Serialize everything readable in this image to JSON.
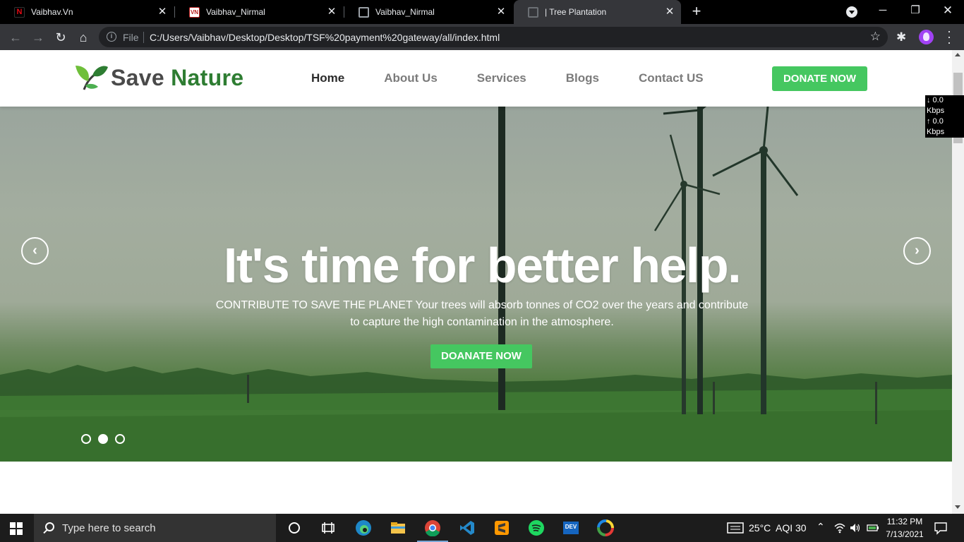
{
  "tabs": [
    {
      "title": "Vaibhav.Vn",
      "icon": "netflix-n-icon"
    },
    {
      "title": "Vaibhav_Nirmal",
      "icon": "vn-logo-icon"
    },
    {
      "title": "Vaibhav_Nirmal",
      "icon": "globe-icon"
    },
    {
      "title": "| Tree Plantation",
      "icon": "globe-icon",
      "active": true
    }
  ],
  "omnibox": {
    "scheme_label": "File",
    "url": "C:/Users/Vaibhav/Desktop/Desktop/TSF%20payment%20gateway/all/index.html"
  },
  "site": {
    "logo": {
      "word1": "Save",
      "word2": "Nature"
    },
    "nav": [
      "Home",
      "About Us",
      "Services",
      "Blogs",
      "Contact US"
    ],
    "active_nav": "Home",
    "donate_label": "DONATE NOW"
  },
  "hero": {
    "title": "It's time for better help.",
    "subtitle": "CONTRIBUTE TO SAVE THE PLANET Your trees will absorb tonnes of CO2 over the years and contribute to capture the high contamination in the atmosphere.",
    "button_label": "DOANATE NOW",
    "slide_count": 3,
    "active_slide": 2
  },
  "speed_meter": {
    "down": "↓ 0.0 Kbps",
    "up": "↑ 0.0 Kbps"
  },
  "taskbar": {
    "search_placeholder": "Type here to search",
    "weather": "25°C",
    "aqi": "AQI 30",
    "time": "11:32 PM",
    "date": "7/13/2021"
  },
  "colors": {
    "accent_green": "#45c760",
    "logo_green": "#2e7d32"
  }
}
